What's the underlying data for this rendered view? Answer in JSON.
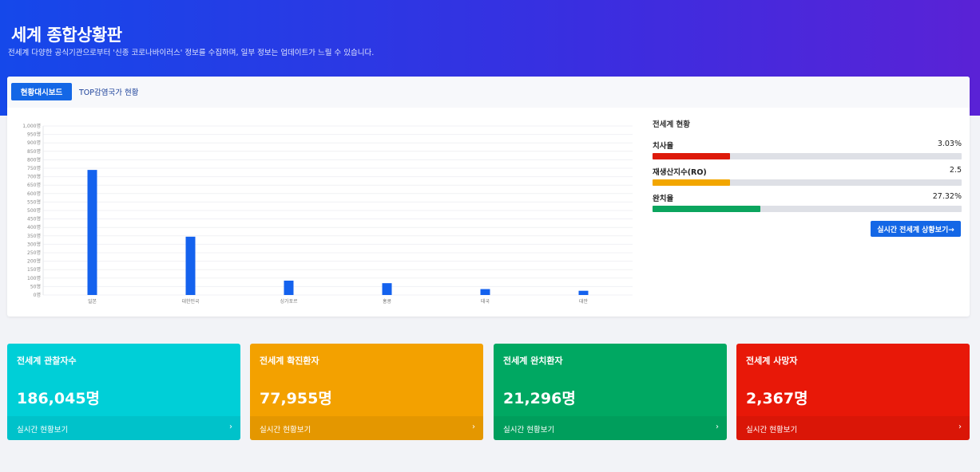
{
  "header": {
    "title": "세계 종합상황판",
    "subtitle": "전세계 다양한 공식기관으로부터 '신종 코로나바이러스' 정보를 수집하며, 일부 정보는 업데이트가 느릴 수 있습니다."
  },
  "tabs": [
    {
      "label": "현황대시보드",
      "active": true
    },
    {
      "label": "TOP감염국가 현황",
      "active": false
    }
  ],
  "chart_data": {
    "type": "bar",
    "categories": [
      "일본",
      "대한민국",
      "싱가포르",
      "홍콩",
      "태국",
      "대만"
    ],
    "values": [
      740,
      345,
      85,
      70,
      35,
      25
    ],
    "ylim": [
      0,
      1000
    ],
    "y_ticks": [
      0,
      50,
      100,
      150,
      200,
      250,
      300,
      350,
      400,
      450,
      500,
      550,
      600,
      650,
      700,
      750,
      800,
      850,
      900,
      950,
      1000
    ],
    "y_tick_suffix": "명",
    "grid": true,
    "color": "#1462ee"
  },
  "world_status": {
    "title": "전세계 현황",
    "items": [
      {
        "label": "치사율",
        "value": "3.03%",
        "fill": 0.25,
        "color": "#dd1a0a"
      },
      {
        "label": "재생산지수(RO)",
        "value": "2.5",
        "fill": 0.25,
        "color": "#f2a600"
      },
      {
        "label": "완치율",
        "value": "27.32%",
        "fill": 0.35,
        "color": "#0ba55e"
      }
    ],
    "button_label": "실시간 전세계 상황보기→"
  },
  "cards": [
    {
      "title": "전세계 관찰자수",
      "value": "186,045명",
      "link": "실시간 현황보기",
      "arrow": "›",
      "color": "#00cfd7"
    },
    {
      "title": "전세계 확진환자",
      "value": "77,955명",
      "link": "실시간 현황보기",
      "arrow": "›",
      "color": "#f3a100"
    },
    {
      "title": "전세계 완치환자",
      "value": "21,296명",
      "link": "실시간 현황보기",
      "arrow": "›",
      "color": "#00a862"
    },
    {
      "title": "전세계 사망자",
      "value": "2,367명",
      "link": "실시간 현황보기",
      "arrow": "›",
      "color": "#e81808"
    }
  ]
}
